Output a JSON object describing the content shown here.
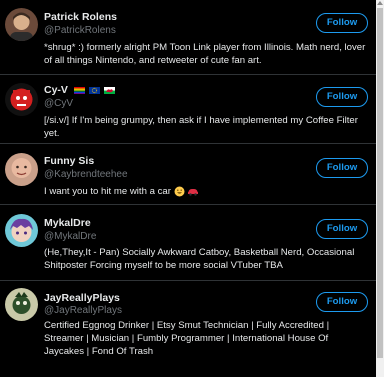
{
  "follow_label": "Follow",
  "users": [
    {
      "name": "Patrick Rolens",
      "handle": "@PatrickRolens",
      "bio": "*shrug* :) formerly alright PM Toon Link player from Illinois. Math nerd, lover of all things Nintendo, and retweeter of cute fan art."
    },
    {
      "name": "Cy-V",
      "handle": "@CyV",
      "flags": [
        "rainbow-flag-icon",
        "eu-flag-icon",
        "wales-flag-icon"
      ],
      "bio": "[/si.v/] If I'm being grumpy, then ask if I have implemented my Coffee Filter yet."
    },
    {
      "name": "Funny Sis",
      "handle": "@Kaybrendteehee",
      "bio": "I want you to hit me with a car",
      "bio_emojis": [
        "grinning-face-icon",
        "car-icon"
      ]
    },
    {
      "name": "MykalDre",
      "handle": "@MykalDre",
      "bio": "(He,They,It - Pan) Socially Awkward Catboy, Basketball Nerd, Occasional Shitposter Forcing myself to be more social VTuber TBA"
    },
    {
      "name": "JayReallyPlays",
      "handle": "@JayReallyPlays",
      "bio": "Certified Eggnog Drinker | Etsy Smut Technician | Fully Accredited | Streamer | Musician | Fumbly Programmer | International House Of Jaycakes | Fond Of Trash"
    }
  ],
  "colors": {
    "background": "#000000",
    "accent": "#1d9bf0",
    "secondary_text": "#71767b",
    "divider": "#2f3336"
  }
}
